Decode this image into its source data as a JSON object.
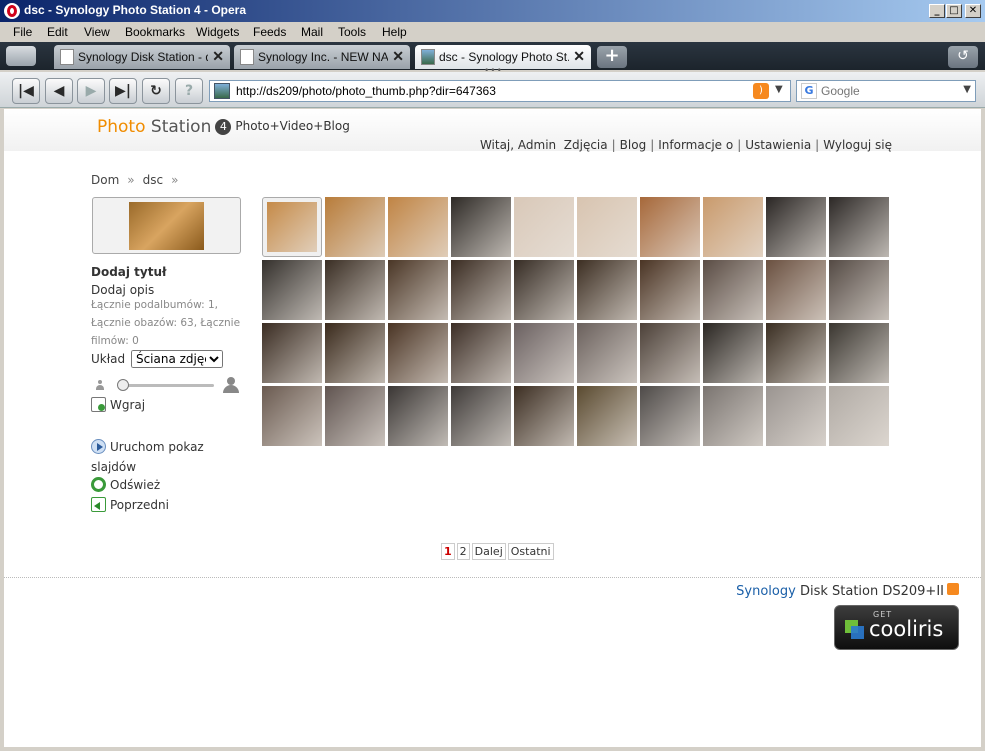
{
  "window": {
    "title": "dsc - Synology Photo Station 4 - Opera",
    "minimize": "_",
    "maximize": "□",
    "close": "✕"
  },
  "menu": [
    "File",
    "Edit",
    "View",
    "Bookmarks",
    "Widgets",
    "Feeds",
    "Mail",
    "Tools",
    "Help"
  ],
  "tabs": [
    {
      "label": "Synology Disk Station - d...",
      "active": false
    },
    {
      "label": "Synology Inc. - NEW NA...",
      "active": false
    },
    {
      "label": "dsc - Synology Photo St...",
      "active": true
    }
  ],
  "tab_close": "✕",
  "new_tab": "+",
  "address": {
    "url": "http://ds209/photo/photo_thumb.php?dir=647363"
  },
  "search": {
    "engine": "Google",
    "placeholder": "Google"
  },
  "site": {
    "logo_photo": "Photo",
    "logo_station": "Station",
    "logo_version": "4",
    "logo_tagline": "Photo+Video+Blog",
    "nav": {
      "welcome": "Witaj, Admin",
      "photos": "Zdjęcia",
      "blog": "Blog",
      "about": "Informacje o",
      "settings": "Ustawienia",
      "logout": "Wyloguj się"
    },
    "breadcrumb": [
      "Dom",
      "dsc"
    ]
  },
  "sidebar": {
    "title": "Dodaj tytuł",
    "description": "Dodaj opis",
    "stats": "Łącznie podalbumów: 1, Łącznie obazów: 63, Łącznie filmów: 0",
    "layout_label": "Układ",
    "layout_value": "Ściana zdjęć",
    "upload": "Wgraj",
    "slideshow": "Uruchom pokaz slajdów",
    "refresh": "Odśwież",
    "previous": "Poprzedni"
  },
  "thumbnails": [
    "#c58a48",
    "#b87c3a",
    "#c08444",
    "#2e2a26",
    "#d9c8b8",
    "#d8c4b0",
    "#a6683a",
    "#c99a6c",
    "#2a2624",
    "#2c2826",
    "#34302c",
    "#3a2e24",
    "#4a3626",
    "#3a2c22",
    "#362c24",
    "#3c2e22",
    "#4a3424",
    "#5a4c44",
    "#6a5040",
    "#544a44",
    "#3a2c22",
    "#3a2a1c",
    "#4a3424",
    "#3c2e26",
    "#6a6060",
    "#6a605c",
    "#4c4038",
    "#2a2622",
    "#3a2e22",
    "#3a3630",
    "#6a5a50",
    "#605450",
    "#3a3634",
    "#3e3a38",
    "#3c2e22",
    "#5a4a30",
    "#4e4a48",
    "#7a7470",
    "#9a9490",
    "#b0aaa4"
  ],
  "pagination": {
    "current": "1",
    "pages": [
      "2"
    ],
    "next": "Dalej",
    "last": "Ostatni"
  },
  "footer": {
    "brand": "Synology",
    "model": "Disk Station DS209+II",
    "cooliris_get": "GET",
    "cooliris_name": "cooliris"
  }
}
